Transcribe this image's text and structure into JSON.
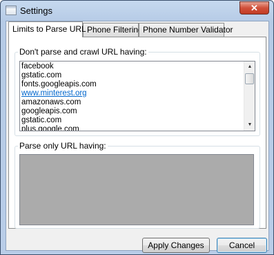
{
  "window": {
    "title": "Settings",
    "close_label": "✕"
  },
  "tabs": [
    {
      "label": "Limits to Parse URL",
      "active": true
    },
    {
      "label": "Phone Filtering",
      "active": false
    },
    {
      "label": "Phone Number Validator",
      "active": false
    }
  ],
  "group_exclude": {
    "label": "Don't parse and crawl URL having:",
    "items": [
      {
        "text": "facebook",
        "link": false
      },
      {
        "text": "gstatic.com",
        "link": false
      },
      {
        "text": "fonts.googleapis.com",
        "link": false
      },
      {
        "text": "www.minterest.org",
        "link": true
      },
      {
        "text": "amazonaws.com",
        "link": false
      },
      {
        "text": "googleapis.com",
        "link": false
      },
      {
        "text": "gstatic.com",
        "link": false
      },
      {
        "text": "plus.google.com",
        "link": false
      }
    ]
  },
  "group_only": {
    "label": "Parse only URL having:"
  },
  "buttons": {
    "apply": "Apply Changes",
    "cancel": "Cancel"
  },
  "icons": {
    "scroll_up": "▲",
    "scroll_down": "▼"
  }
}
